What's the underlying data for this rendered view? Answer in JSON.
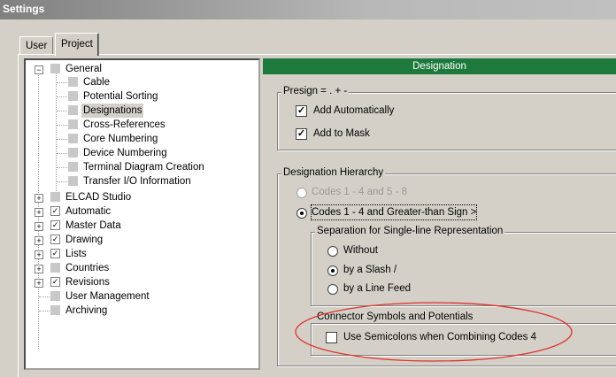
{
  "window": {
    "title": "Settings"
  },
  "tabs": [
    {
      "label": "User"
    },
    {
      "label": "Project"
    }
  ],
  "tree": {
    "general": {
      "label": "General",
      "expander": "−"
    },
    "general_children": [
      {
        "label": "Cable"
      },
      {
        "label": "Potential Sorting"
      },
      {
        "label": "Designations"
      },
      {
        "label": "Cross-References"
      },
      {
        "label": "Core Numbering"
      },
      {
        "label": "Device Numbering"
      },
      {
        "label": "Terminal Diagram Creation"
      },
      {
        "label": "Transfer I/O Information"
      }
    ],
    "elcad": {
      "label": "ELCAD Studio",
      "expander": "+"
    },
    "automatic": {
      "label": "Automatic",
      "expander": "+",
      "check": "✓"
    },
    "master_data": {
      "label": "Master Data",
      "expander": "+",
      "check": "✓"
    },
    "drawing": {
      "label": "Drawing",
      "expander": "+",
      "check": "✓"
    },
    "lists": {
      "label": "Lists",
      "expander": "+",
      "check": "✓"
    },
    "countries": {
      "label": "Countries",
      "expander": "+"
    },
    "revisions": {
      "label": "Revisions",
      "expander": "+",
      "check": "✓"
    },
    "user_management": {
      "label": "User Management"
    },
    "archiving": {
      "label": "Archiving"
    }
  },
  "panel": {
    "header": "Designation",
    "presign": {
      "label": "Presign = . + -",
      "add_automatically": {
        "label": "Add Automatically",
        "checked": true,
        "mark": "✓"
      },
      "add_to_mask": {
        "label": "Add to Mask",
        "checked": true,
        "mark": "✓"
      }
    },
    "hierarchy": {
      "label": "Designation Hierarchy",
      "option1": {
        "label": "Codes 1 - 4 and 5 - 8",
        "selected": false,
        "disabled": true
      },
      "option2": {
        "label": "Codes 1 - 4 and Greater-than Sign >",
        "selected": true
      },
      "separation": {
        "label": "Separation for Single-line Representation",
        "without": {
          "label": "Without",
          "selected": false
        },
        "slash": {
          "label": "by a Slash /",
          "selected": true
        },
        "line_feed": {
          "label": "by a Line Feed",
          "selected": false
        }
      },
      "connector": {
        "label": "Connector Symbols and Potentials",
        "semicolons": {
          "label": "Use Semicolons when Combining Codes 4",
          "checked": false
        }
      }
    },
    "annotation_color": "#e0302a"
  }
}
